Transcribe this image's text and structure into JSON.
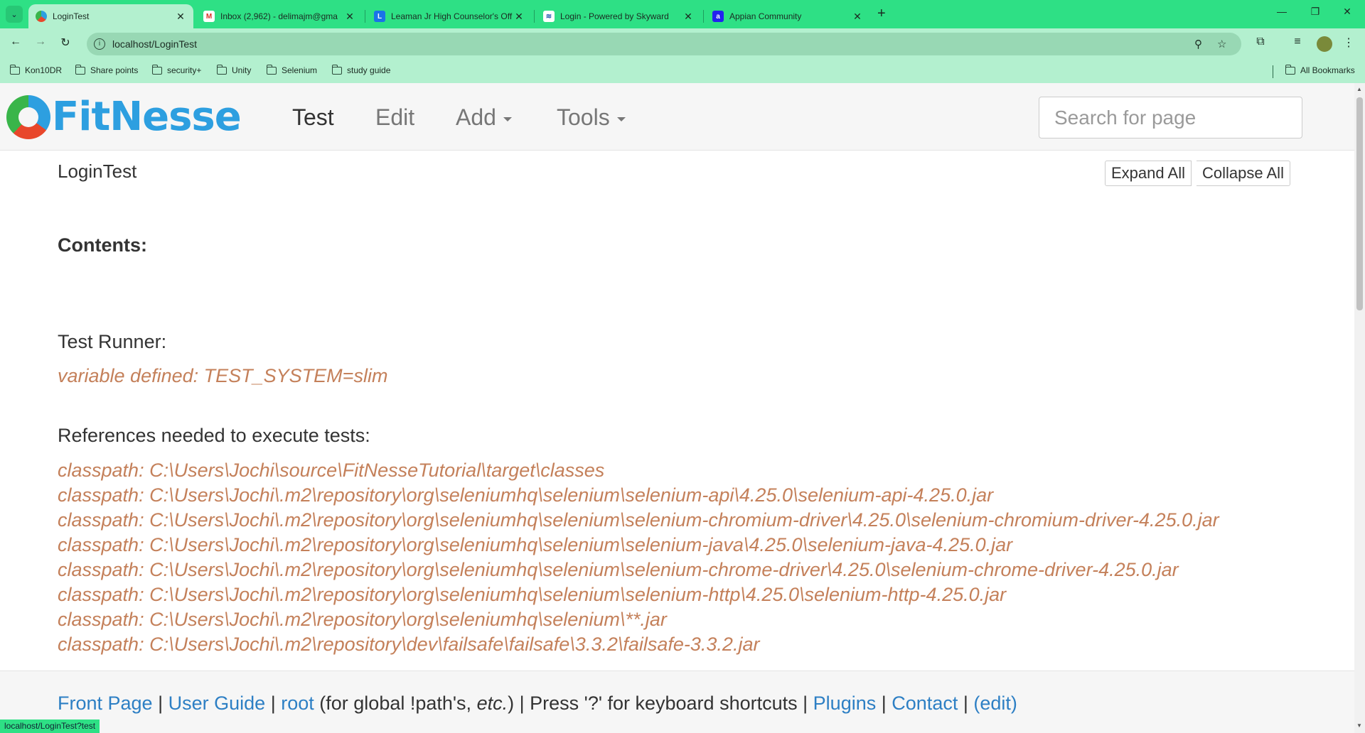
{
  "browser": {
    "tabs": [
      {
        "title": "LoginTest",
        "active": true,
        "favicon": "fitnesse-icon"
      },
      {
        "title": "Inbox (2,962) - delimajm@gma",
        "active": false,
        "favicon": "gmail-icon"
      },
      {
        "title": "Leaman Jr High Counselor's Off",
        "active": false,
        "favicon": "doc-icon"
      },
      {
        "title": "Login - Powered by Skyward",
        "active": false,
        "favicon": "skyward-icon"
      },
      {
        "title": "Appian Community",
        "active": false,
        "favicon": "appian-icon"
      }
    ],
    "url": "localhost/LoginTest",
    "bookmarks": [
      "Kon10DR",
      "Share points",
      "security+",
      "Unity",
      "Selenium",
      "study guide"
    ],
    "all_bookmarks": "All Bookmarks",
    "status_url": "localhost/LoginTest?test",
    "theme_color": "#2ee085"
  },
  "fitnesse": {
    "logo": "FitNesse",
    "menu": {
      "test": "Test",
      "edit": "Edit",
      "add": "Add",
      "tools": "Tools"
    },
    "search_placeholder": "Search for page",
    "page_title": "LoginTest",
    "expand_all": "Expand All",
    "collapse_all": "Collapse All",
    "contents_label": "Contents:",
    "test_runner_heading": "Test Runner:",
    "test_system_var": "variable defined: TEST_SYSTEM=slim",
    "references_heading": "References needed to execute tests:",
    "classpaths": [
      "classpath: C:\\Users\\Jochi\\source\\FitNesseTutorial\\target\\classes",
      "classpath: C:\\Users\\Jochi\\.m2\\repository\\org\\seleniumhq\\selenium\\selenium-api\\4.25.0\\selenium-api-4.25.0.jar",
      "classpath: C:\\Users\\Jochi\\.m2\\repository\\org\\seleniumhq\\selenium\\selenium-chromium-driver\\4.25.0\\selenium-chromium-driver-4.25.0.jar",
      "classpath: C:\\Users\\Jochi\\.m2\\repository\\org\\seleniumhq\\selenium\\selenium-java\\4.25.0\\selenium-java-4.25.0.jar",
      "classpath: C:\\Users\\Jochi\\.m2\\repository\\org\\seleniumhq\\selenium\\selenium-chrome-driver\\4.25.0\\selenium-chrome-driver-4.25.0.jar",
      "classpath: C:\\Users\\Jochi\\.m2\\repository\\org\\seleniumhq\\selenium\\selenium-http\\4.25.0\\selenium-http-4.25.0.jar",
      "classpath: C:\\Users\\Jochi\\.m2\\repository\\org\\seleniumhq\\selenium\\**.jar",
      "classpath: C:\\Users\\Jochi\\.m2\\repository\\dev\\failsafe\\failsafe\\3.3.2\\failsafe-3.3.2.jar"
    ],
    "footer": {
      "front_page": "Front Page",
      "user_guide": "User Guide",
      "root": "root",
      "root_note_pre": "(for global !path's, ",
      "root_note_etc": "etc.",
      "root_note_post": ")",
      "shortcuts": "Press '?' for keyboard shortcuts",
      "plugins": "Plugins",
      "contact": "Contact",
      "edit": "(edit)",
      "separator": "|"
    },
    "link_color": "#2d7fc4",
    "variable_color": "#c4805a"
  }
}
